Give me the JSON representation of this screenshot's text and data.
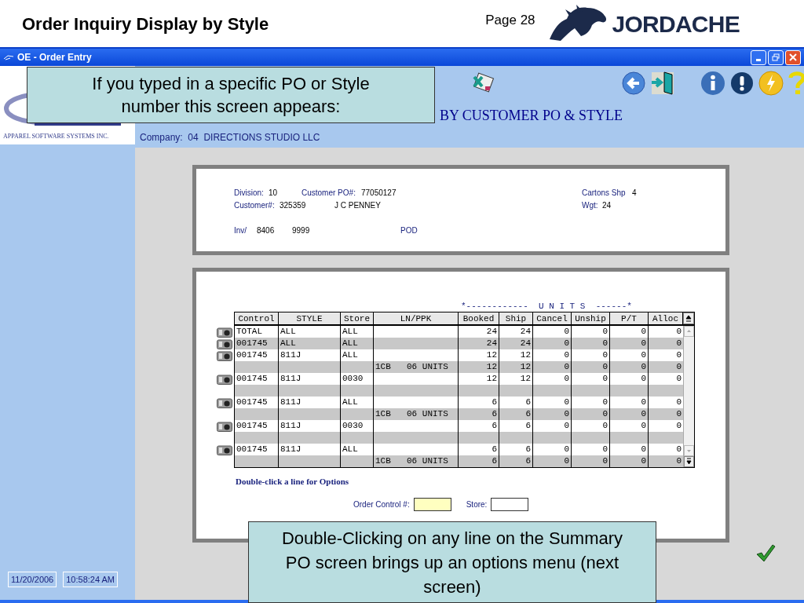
{
  "slide": {
    "title": "Order Inquiry Display by Style",
    "page": "Page 28",
    "brand": "JORDACHE"
  },
  "window": {
    "title": "OE - Order Entry"
  },
  "logo": {
    "tagline": "APPAREL SOFTWARE SYSTEMS INC."
  },
  "screen_title": "BY CUSTOMER PO & STYLE",
  "company": "Company:  04  DIRECTIONS STUDIO LLC",
  "order_header": {
    "division": {
      "label": "Division:",
      "value": "10"
    },
    "customer_po": {
      "label": "Customer PO#:",
      "value": "77050127"
    },
    "customer": {
      "label": "Customer#:",
      "value": "325359"
    },
    "customer_name": "J C PENNEY",
    "cartons": {
      "label": "Cartons Shp",
      "value": "4"
    },
    "weight": {
      "label": "Wgt:",
      "value": "24"
    },
    "invoice": {
      "label": "Inv/",
      "value": "8406",
      "value_2": "9999"
    },
    "status": "POD"
  },
  "units_banner": "*------------  U N I T S  ------*",
  "table": {
    "columns": [
      "Control",
      "STYLE",
      "Store",
      "LN/PPK",
      "Booked",
      "Ship",
      "Cancel",
      "Unship",
      "P/T",
      "Alloc"
    ],
    "rows": [
      {
        "kind": "entry",
        "control": "TOTAL",
        "style": "ALL",
        "store": "ALL",
        "units": [
          "24",
          "24",
          "0",
          "0",
          "0",
          "0"
        ]
      },
      {
        "kind": "entry",
        "control": "001745",
        "style": "ALL",
        "store": "ALL",
        "units": [
          "24",
          "24",
          "0",
          "0",
          "0",
          "0"
        ]
      },
      {
        "kind": "entry",
        "control": "001745",
        "style": "811J",
        "store": "ALL",
        "units": [
          "12",
          "12",
          "0",
          "0",
          "0",
          "0"
        ]
      },
      {
        "kind": "pack",
        "ln": "1CB",
        "ppk": "06 UNITS",
        "units": [
          "12",
          "12",
          "0",
          "0",
          "0",
          "0"
        ]
      },
      {
        "kind": "entry",
        "control": "001745",
        "style": "811J",
        "store": "0030",
        "units": [
          "12",
          "12",
          "0",
          "0",
          "0",
          "0"
        ]
      },
      {
        "kind": "blank"
      },
      {
        "kind": "entry",
        "control": "001745",
        "style": "811J",
        "store": "ALL",
        "units": [
          "6",
          "6",
          "0",
          "0",
          "0",
          "0"
        ]
      },
      {
        "kind": "pack",
        "ln": "1CB",
        "ppk": "06 UNITS",
        "units": [
          "6",
          "6",
          "0",
          "0",
          "0",
          "0"
        ]
      },
      {
        "kind": "entry",
        "control": "001745",
        "style": "811J",
        "store": "0030",
        "units": [
          "6",
          "6",
          "0",
          "0",
          "0",
          "0"
        ]
      },
      {
        "kind": "blank"
      },
      {
        "kind": "entry",
        "control": "001745",
        "style": "811J",
        "store": "ALL",
        "units": [
          "6",
          "6",
          "0",
          "0",
          "0",
          "0"
        ]
      },
      {
        "kind": "pack",
        "ln": "1CB",
        "ppk": "06 UNITS",
        "units": [
          "6",
          "6",
          "0",
          "0",
          "0",
          "0"
        ]
      }
    ]
  },
  "hint": "Double-click a line for Options",
  "fields": {
    "order_control": {
      "label": "Order Control #:"
    },
    "store": {
      "label": "Store:"
    }
  },
  "status": {
    "date": "11/20/2006",
    "time": "10:58:24 AM"
  },
  "callouts": [
    "If you typed in a specific PO or Style number this screen appears:",
    "Double-Clicking on any line on the Summary PO screen brings up an options menu (next screen)"
  ]
}
